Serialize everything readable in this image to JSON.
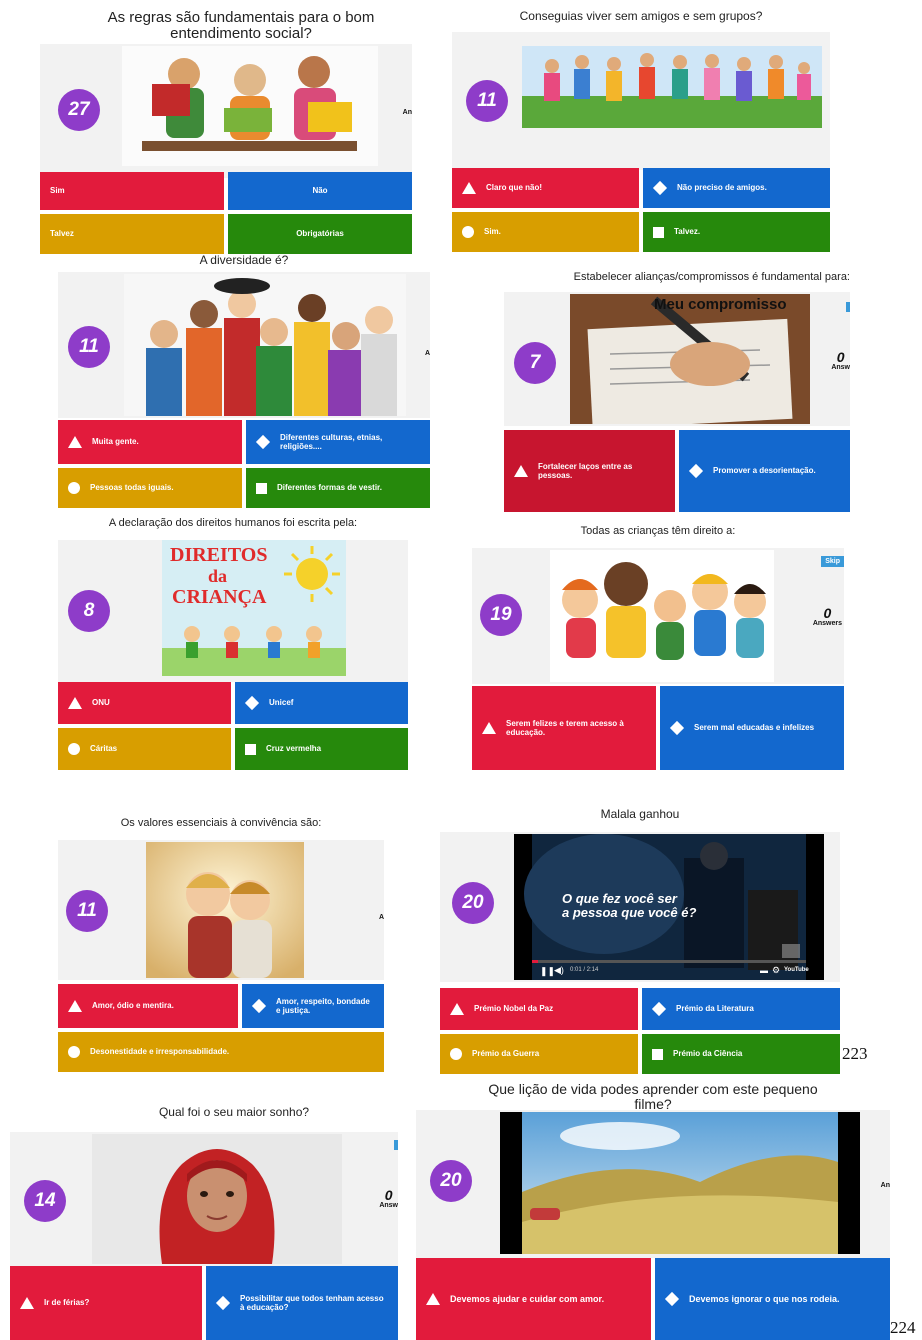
{
  "q1": {
    "title": "As regras são fundamentais para o bom\nentendimento social?",
    "timer": "27",
    "answers_cut": "An",
    "options": {
      "a": "Sim",
      "b": "Não",
      "c": "Talvez",
      "d": "Obrigatórias"
    }
  },
  "q2": {
    "title": "Conseguias viver sem amigos e sem grupos?",
    "timer": "11",
    "options": {
      "a": "Claro que não!",
      "b": "Não preciso de amigos.",
      "c": "Sim.",
      "d": "Talvez."
    }
  },
  "q3": {
    "title": "A diversidade é?",
    "timer": "11",
    "answers_cut": "A",
    "options": {
      "a": "Muita gente.",
      "b": "Diferentes culturas, etnias, religiões....",
      "c": "Pessoas todas iguais.",
      "d": "Diferentes formas de vestir."
    }
  },
  "q4": {
    "title": "Estabelecer alianças/compromissos é fundamental para:",
    "timer": "7",
    "image_caption": "Meu compromisso",
    "answers_count": "0",
    "answers_label": "Answ",
    "options": {
      "a": "Fortalecer laços entre as pessoas.",
      "b": "Promover a desorientação."
    }
  },
  "q5": {
    "title": "A declaração dos direitos humanos foi escrita pela:",
    "timer": "8",
    "image_text": {
      "l1": "DIREITOS",
      "l2": "da",
      "l3": "CRIANÇA"
    },
    "options": {
      "a": "ONU",
      "b": "Unicef",
      "c": "Cáritas",
      "d": "Cruz vermelha"
    }
  },
  "q6": {
    "title": "Todas as crianças têm direito a:",
    "timer": "19",
    "skip": "Skip",
    "answers_count": "0",
    "answers_label": "Answers",
    "options": {
      "a": "Serem felizes e terem acesso à educação.",
      "b": "Serem mal educadas e infelizes"
    }
  },
  "q7": {
    "title": "Os valores essenciais à convivência são:",
    "timer": "11",
    "answers_cut": "A",
    "options": {
      "a": "Amor, ódio e mentira.",
      "b": "Amor, respeito, bondade e justiça.",
      "c": "Desonestidade e irresponsabilidade."
    }
  },
  "q8": {
    "title": "Malala ganhou",
    "timer": "20",
    "video_caption": "O que fez você ser\na pessoa que você é?",
    "video_time": "0:01 / 2:14",
    "video_brand": "YouTube",
    "options": {
      "a": "Prémio Nobel da Paz",
      "b": "Prémio da Literatura",
      "c": "Prémio da Guerra",
      "d": "Prémio da Ciência"
    }
  },
  "q9": {
    "title": "Qual foi o seu maior sonho?",
    "timer": "14",
    "answers_count": "0",
    "answers_label": "Answ",
    "options": {
      "a": "Ir de férias?",
      "b": "Possibilitar que todos tenham acesso à educação?"
    }
  },
  "q10": {
    "title": "Que lição de vida podes aprender com este pequeno\nfilme?",
    "timer": "20",
    "answers_cut": "An",
    "options": {
      "a": "Devemos ajudar e cuidar com amor.",
      "b": "Devemos ignorar o que nos rodeia."
    }
  },
  "page_numbers": {
    "p1": "223",
    "p2": "224"
  }
}
